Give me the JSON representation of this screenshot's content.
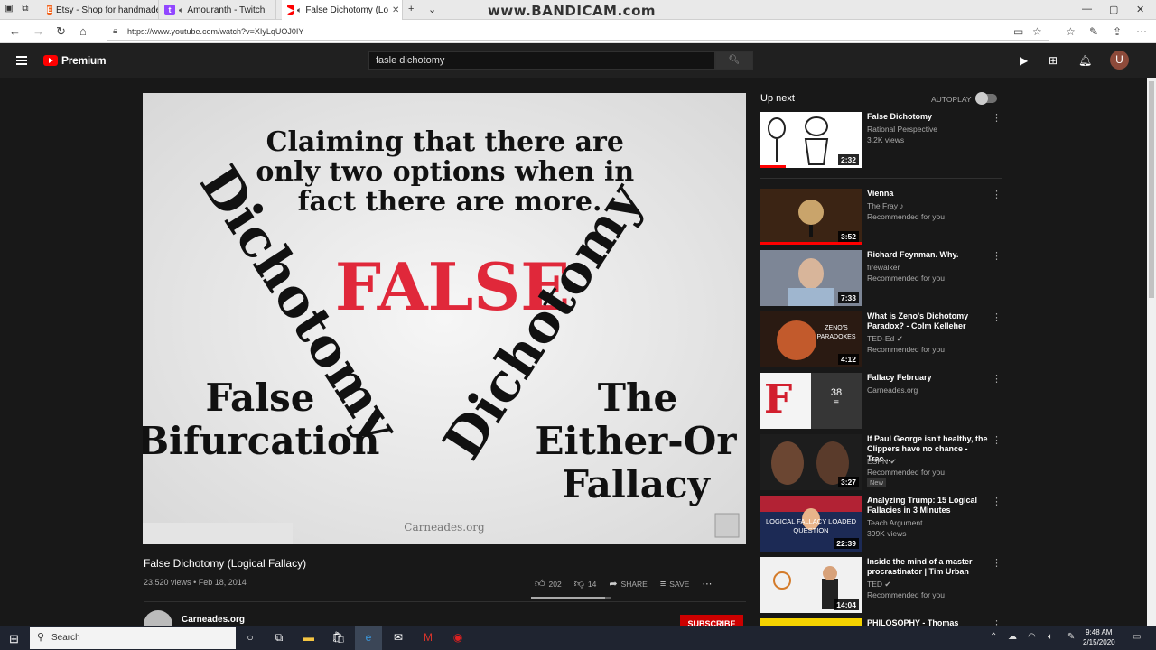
{
  "browser": {
    "tabs": [
      {
        "label": "Etsy - Shop for handmade, v",
        "favicon": "etsy-icon"
      },
      {
        "label": "Amouranth - Twitch",
        "favicon": "twitch-icon"
      },
      {
        "label": "False Dichotomy (Lo",
        "favicon": "youtube-icon",
        "active": true
      }
    ],
    "watermark": "www.BANDICAM.com",
    "url": "https://www.youtube.com/watch?v=XIyLqUOJ0IY"
  },
  "youtube": {
    "brand": "Premium",
    "search_value": "fasle dichotomy",
    "avatar_letter": "U"
  },
  "video": {
    "frame": {
      "definition": "Claiming that there are only two options when in fact there are more.",
      "definition_lines": [
        "Claiming that there are",
        "only two options when in",
        "fact there are more."
      ],
      "false_word": "FALSE",
      "dichotomy_word": "Dichotomy",
      "left_alt_1": "False",
      "left_alt_2": "Bifurcation",
      "right_alt_1": "The",
      "right_alt_2": "Either-Or",
      "right_alt_3": "Fallacy",
      "site": "Carneades.org"
    },
    "title": "False Dichotomy (Logical Fallacy)",
    "views": "23,520 views",
    "date": "Feb 18, 2014",
    "likes": "202",
    "dislikes": "14",
    "like_ratio": 0.935,
    "share_label": "SHARE",
    "save_label": "SAVE",
    "channel": "Carneades.org",
    "subscribe_label": "SUBSCRIBE"
  },
  "upnext": {
    "heading": "Up next",
    "autoplay_label": "AUTOPLAY",
    "autoplay_on": false,
    "items": [
      {
        "title": "False Dichotomy",
        "channel": "Rational Perspective",
        "info": "3.2K views",
        "duration": "2:32",
        "progress": 0.25
      },
      {
        "title": "Vienna",
        "channel": "The Fray ♪",
        "info": "Recommended for you",
        "duration": "3:52",
        "progress": 1.0
      },
      {
        "title": "Richard Feynman. Why.",
        "channel": "firewalker",
        "info": "Recommended for you",
        "duration": "7:33"
      },
      {
        "title": "What is Zeno's Dichotomy Paradox? - Colm Kelleher",
        "channel": "TED-Ed ✔",
        "info": "Recommended for you",
        "duration": "4:12"
      },
      {
        "title": "Fallacy February",
        "channel": "Carneades.org",
        "info": "",
        "playlist_count": "38"
      },
      {
        "title": "If Paul George isn't healthy, the Clippers have no chance - Trac...",
        "channel": "ESPN ✔",
        "info": "Recommended for you",
        "badge": "New",
        "duration": "3:27"
      },
      {
        "title": "Analyzing Trump: 15 Logical Fallacies in 3 Minutes",
        "channel": "Teach Argument",
        "info": "399K views",
        "duration": "22:39",
        "thumb_text": "LOGICAL FALLACY LOADED QUESTION"
      },
      {
        "title": "Inside the mind of a master procrastinator | Tim Urban",
        "channel": "TED ✔",
        "info": "Recommended for you",
        "duration": "14:04"
      },
      {
        "title": "PHILOSOPHY - Thomas",
        "channel": "",
        "info": ""
      }
    ]
  },
  "taskbar": {
    "search_label": "Search",
    "time": "9:48 AM",
    "date": "2/15/2020"
  }
}
